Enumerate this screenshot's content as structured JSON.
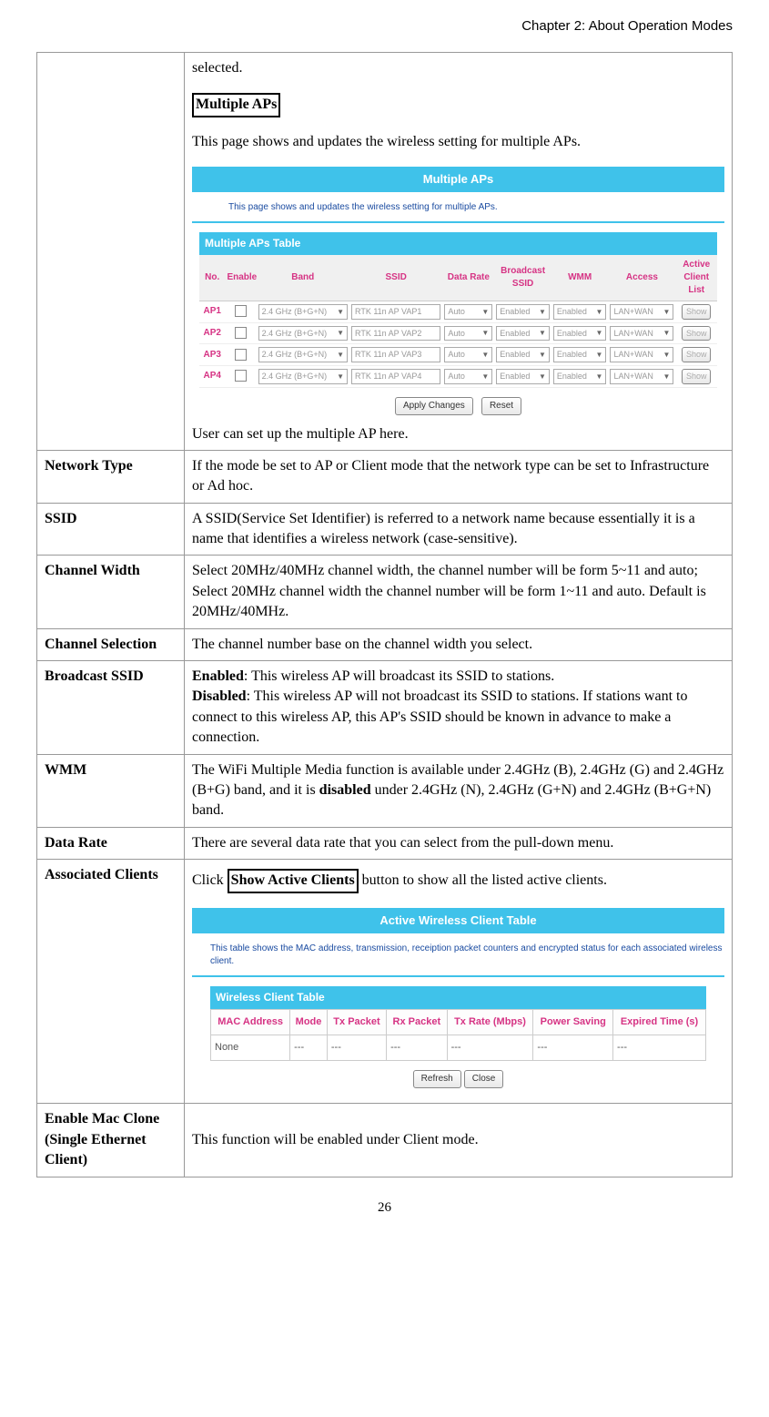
{
  "header": "Chapter 2: About Operation Modes",
  "row1": {
    "text1": "selected.",
    "heading": "Multiple APs",
    "text2": "This page shows and updates the wireless setting for multiple APs.",
    "panel": {
      "title": "Multiple APs",
      "desc": "This page shows and updates the wireless setting for multiple APs.",
      "table_title": "Multiple APs Table",
      "headers": [
        "No.",
        "Enable",
        "Band",
        "SSID",
        "Data Rate",
        "Broadcast SSID",
        "WMM",
        "Access",
        "Active Client List"
      ],
      "rows": [
        {
          "no": "AP1",
          "band": "2.4 GHz (B+G+N)",
          "ssid": "RTK 11n AP VAP1",
          "rate": "Auto",
          "bcast": "Enabled",
          "wmm": "Enabled",
          "access": "LAN+WAN",
          "btn": "Show"
        },
        {
          "no": "AP2",
          "band": "2.4 GHz (B+G+N)",
          "ssid": "RTK 11n AP VAP2",
          "rate": "Auto",
          "bcast": "Enabled",
          "wmm": "Enabled",
          "access": "LAN+WAN",
          "btn": "Show"
        },
        {
          "no": "AP3",
          "band": "2.4 GHz (B+G+N)",
          "ssid": "RTK 11n AP VAP3",
          "rate": "Auto",
          "bcast": "Enabled",
          "wmm": "Enabled",
          "access": "LAN+WAN",
          "btn": "Show"
        },
        {
          "no": "AP4",
          "band": "2.4 GHz (B+G+N)",
          "ssid": "RTK 11n AP VAP4",
          "rate": "Auto",
          "bcast": "Enabled",
          "wmm": "Enabled",
          "access": "LAN+WAN",
          "btn": "Show"
        }
      ],
      "apply": "Apply Changes",
      "reset": "Reset"
    },
    "text3": "User can set up the multiple AP here."
  },
  "rows": [
    {
      "label": "Network Type",
      "desc": " If the mode be set to AP or Client mode that the network type can be set to Infrastructure or Ad hoc."
    },
    {
      "label": "SSID",
      "desc": "A SSID(Service Set Identifier) is referred to a network name because essentially it is a name that identifies a wireless network (case-sensitive)."
    },
    {
      "label": "Channel Width",
      "desc": "Select 20MHz/40MHz channel width, the channel number will be form 5~11 and auto; Select 20MHz channel width the channel number will be form 1~11 and auto. Default is 20MHz/40MHz."
    },
    {
      "label": "Channel Selection",
      "desc": "The channel number base on the channel width you select."
    }
  ],
  "broadcast": {
    "label": "Broadcast SSID",
    "b1": "Enabled",
    "t1": ": This wireless AP will broadcast its SSID to stations.",
    "b2": "Disabled",
    "t2": ": This wireless AP will not broadcast its SSID to stations. If stations want to connect to this wireless AP, this AP's SSID should be known in advance to make a connection."
  },
  "wmm": {
    "label": "WMM",
    "t1": "The WiFi Multiple Media function is available under 2.4GHz (B), 2.4GHz (G) and 2.4GHz (B+G) band, and it is ",
    "b": "disabled",
    "t2": " under 2.4GHz (N), 2.4GHz (G+N) and 2.4GHz (B+G+N) band."
  },
  "datarate": {
    "label": "Data Rate",
    "desc": "There are several data rate that you can select from the pull-down menu."
  },
  "assoc": {
    "label": "Associated Clients",
    "t1": "Click ",
    "btn": "Show Active Clients",
    "t2": " button to show all the listed active clients.",
    "panel": {
      "title": "Active Wireless Client Table",
      "desc": "This table shows the MAC address, transmission, receiption packet counters and encrypted status for each associated wireless client.",
      "table_title": "Wireless Client Table",
      "headers": [
        "MAC Address",
        "Mode",
        "Tx Packet",
        "Rx Packet",
        "Tx Rate (Mbps)",
        "Power Saving",
        "Expired Time (s)"
      ],
      "row": [
        "None",
        "---",
        "---",
        "---",
        "---",
        "---",
        "---"
      ],
      "refresh": "Refresh",
      "close": "Close"
    }
  },
  "macclone": {
    "label": "Enable Mac Clone (Single Ethernet Client)",
    "desc": "This function will be enabled under Client mode."
  },
  "pagenum": "26"
}
